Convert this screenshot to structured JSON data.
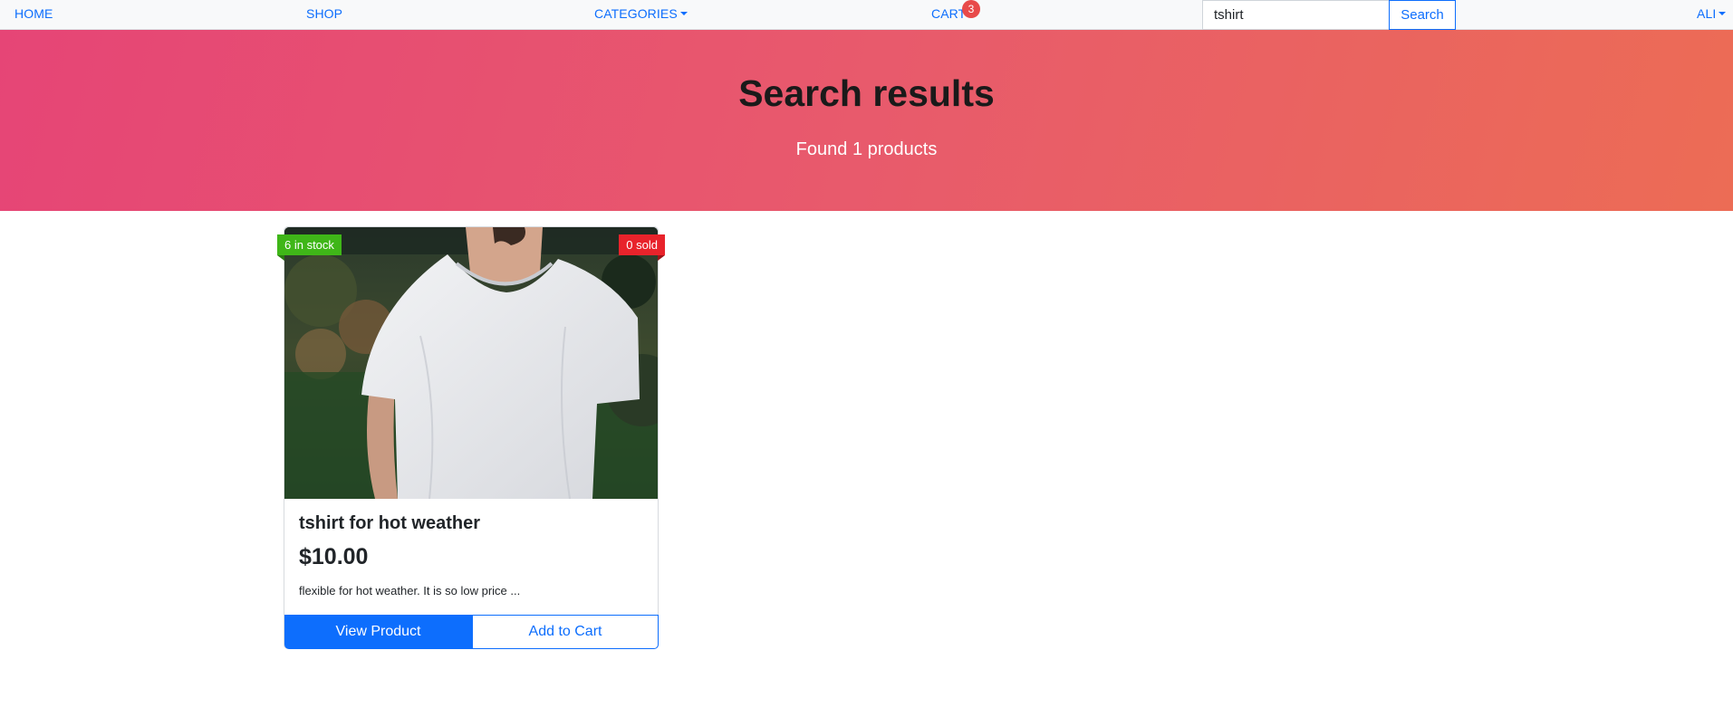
{
  "navbar": {
    "home_label": "HOME",
    "shop_label": "SHOP",
    "categories_label": "CATEGORIES",
    "cart_label": "CART",
    "cart_count": "3",
    "search_value": "tshirt",
    "search_button_label": "Search",
    "user_label": "ALI"
  },
  "hero": {
    "title": "Search results",
    "subtitle": "Found 1 products"
  },
  "products": [
    {
      "stock_badge": "6 in stock",
      "sold_badge": "0 sold",
      "name": "tshirt for hot weather",
      "price": "$10.00",
      "description": "flexible for hot weather. It is so low price ...",
      "view_button": "View Product",
      "cart_button": "Add to Cart"
    }
  ],
  "colors": {
    "primary": "#0d6efd",
    "stock_badge": "#3fb618",
    "sold_badge": "#e8232b",
    "cart_badge": "#e84a4a",
    "hero_gradient_start": "#e64576",
    "hero_gradient_end": "#ec6c55"
  }
}
